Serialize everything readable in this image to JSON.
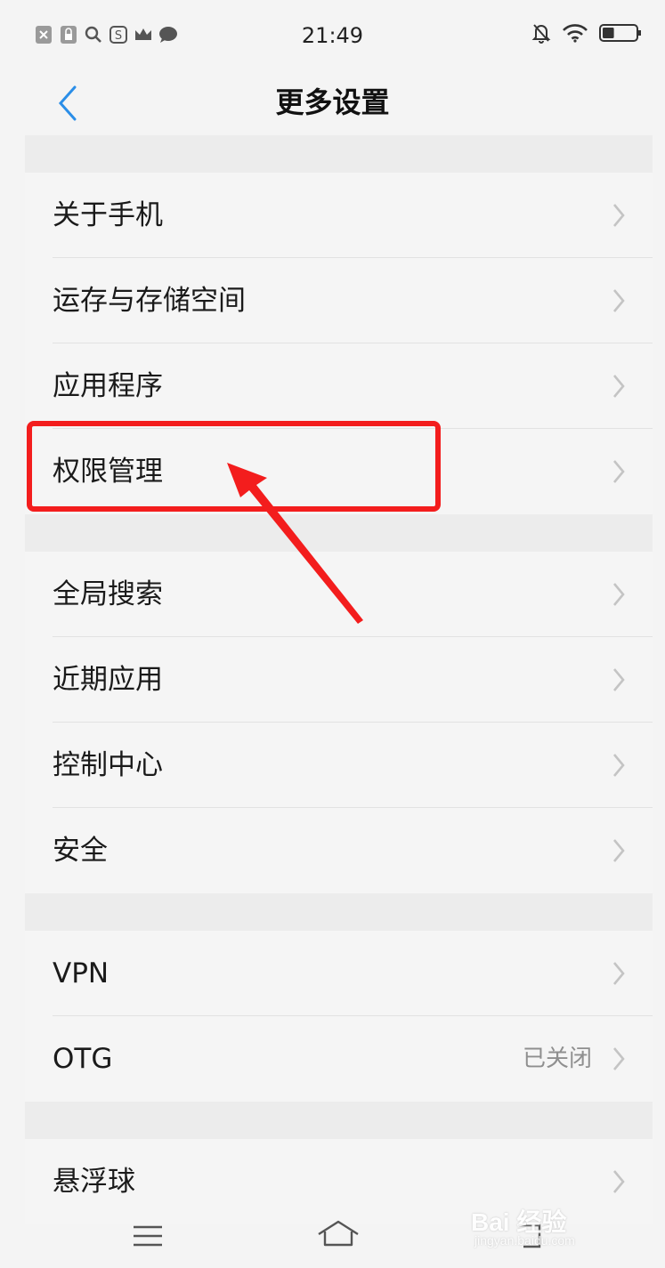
{
  "status": {
    "time": "21:49",
    "left_icons": [
      "sim-off-icon",
      "lock-icon",
      "search-icon",
      "s-app-icon",
      "crown-icon",
      "chat-bubble-icon"
    ],
    "right_icons": [
      "bell-muted-icon",
      "wifi-icon",
      "battery-icon"
    ],
    "battery_level": 0.35
  },
  "header": {
    "title": "更多设置",
    "back_icon": "chevron-left-icon",
    "accent_color": "#2a8ee8"
  },
  "groups": [
    {
      "items": [
        {
          "label": "关于手机"
        },
        {
          "label": "运存与存储空间"
        },
        {
          "label": "应用程序"
        },
        {
          "label": "权限管理"
        }
      ]
    },
    {
      "items": [
        {
          "label": "全局搜索"
        },
        {
          "label": "近期应用"
        },
        {
          "label": "控制中心"
        },
        {
          "label": "安全"
        }
      ]
    },
    {
      "items": [
        {
          "label": "VPN"
        },
        {
          "label": "OTG",
          "value": "已关闭"
        }
      ]
    },
    {
      "items": [
        {
          "label": "悬浮球"
        }
      ]
    }
  ],
  "annotation": {
    "highlight_color": "#f31d1d",
    "highlighted_item": "权限管理"
  },
  "navbar": {
    "icons": [
      "menu-icon",
      "home-icon",
      "back-nav-icon"
    ]
  },
  "watermark": {
    "brand": "Bai 经验",
    "url": "jingyan.baidu.com"
  }
}
